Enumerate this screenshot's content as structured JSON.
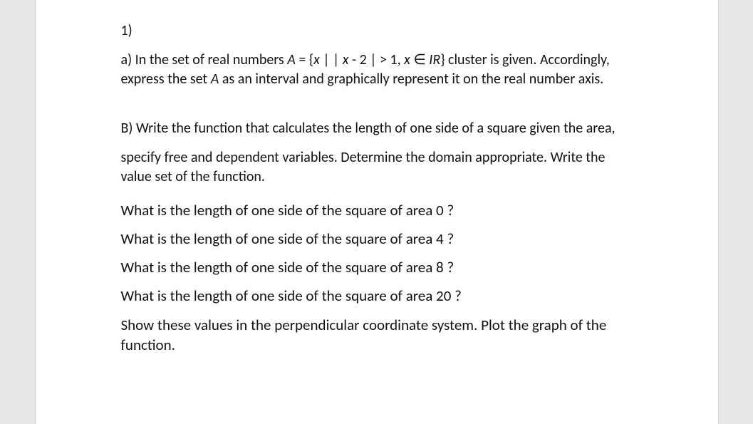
{
  "header": "1)",
  "part_a": "a) In the set of real numbers A = {x | | x - 2 | > 1, x ∈ IR} cluster is given. Accordingly, express the set A as an interval and graphically represent it on the real number axis.",
  "part_b_intro": "B) Write the function that calculates the length of one side of a square given the area,",
  "part_b_spec": "specify free and dependent variables. Determine the domain appropriate. Write the value set of the function.",
  "questions": [
    "What is the length of one side of the square of area 0 ?",
    "What is the length of one side of the square of area 4 ?",
    "What is the length of one side of the square of area 8 ?",
    "What is the length of one side of the square of area 20 ?"
  ],
  "closing": "Show these values in the perpendicular coordinate system. Plot the graph of the function."
}
